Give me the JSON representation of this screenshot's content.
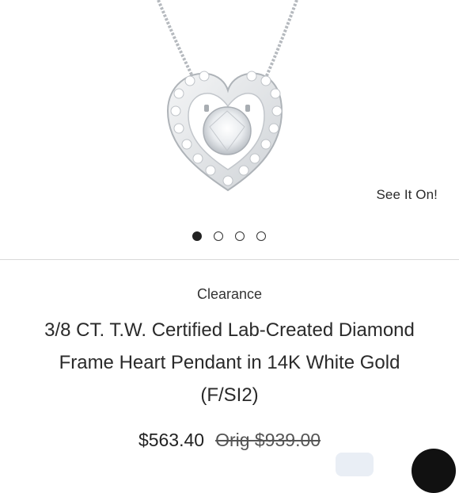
{
  "product": {
    "see_it_on_label": "See It On!",
    "badge": "Clearance",
    "title_line1": "3/8 CT. T.W. Certified Lab-Created Diamond",
    "title_line2": "Frame Heart Pendant in 14K White Gold",
    "title_line3": "(F/SI2)",
    "price": "$563.40",
    "original_price": "Orig $939.00"
  },
  "carousel": {
    "total": 4,
    "active_index": 0
  },
  "colors": {
    "text": "#222222",
    "divider": "#d9d9d9",
    "metal": "#c9cdd2"
  }
}
